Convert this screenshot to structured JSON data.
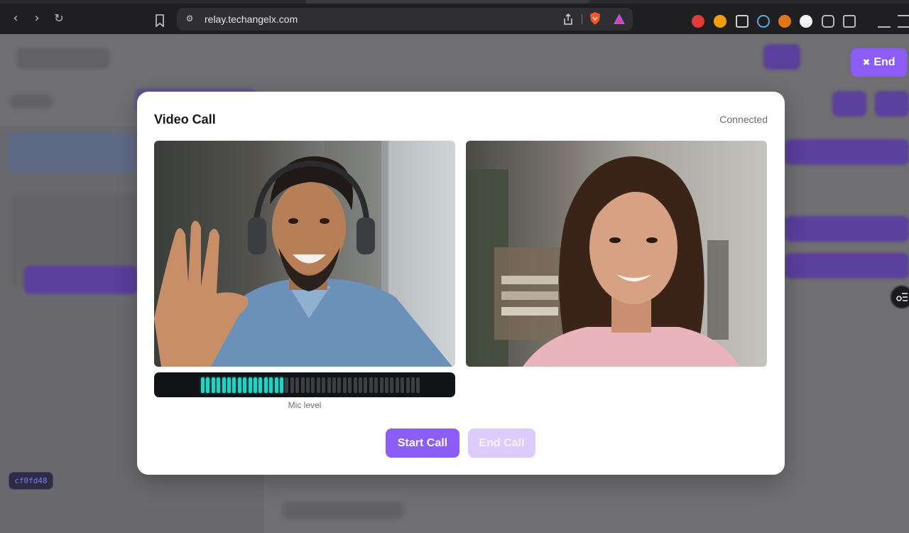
{
  "browser": {
    "url": "relay.techangelx.com"
  },
  "overlay": {
    "end_label": "End"
  },
  "modal": {
    "title": "Video Call",
    "status": "Connected",
    "mic_level_label": "Mic level",
    "mic_level_fraction": 0.38,
    "start_call_label": "Start Call",
    "end_call_label": "End Call"
  },
  "footer": {
    "commit_hash": "cf0fd48"
  },
  "colors": {
    "accent": "#8b5cf6",
    "accent_disabled": "#dcccfb",
    "meter_active": "#22d3c5"
  }
}
